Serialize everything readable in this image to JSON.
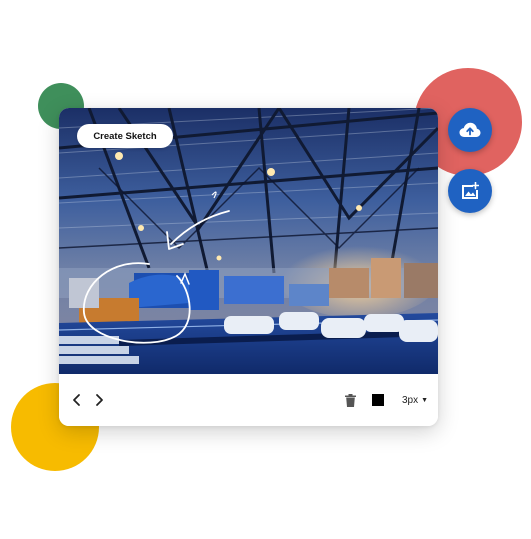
{
  "editor": {
    "create_button_label": "Create Sketch",
    "stroke_width": "3px",
    "brush_color": "#000000"
  },
  "toolbar": {
    "prev_icon": "chevron-left-icon",
    "next_icon": "chevron-right-icon",
    "delete_icon": "trash-icon",
    "stroke_caret_icon": "caret-down-icon"
  },
  "actions": {
    "upload_icon": "cloud-upload-icon",
    "add_image_icon": "add-image-icon",
    "accent_color": "#1f62c2"
  },
  "decor": {
    "green": "#3f8f5b",
    "red": "#e06360",
    "yellow": "#f7bb00"
  }
}
